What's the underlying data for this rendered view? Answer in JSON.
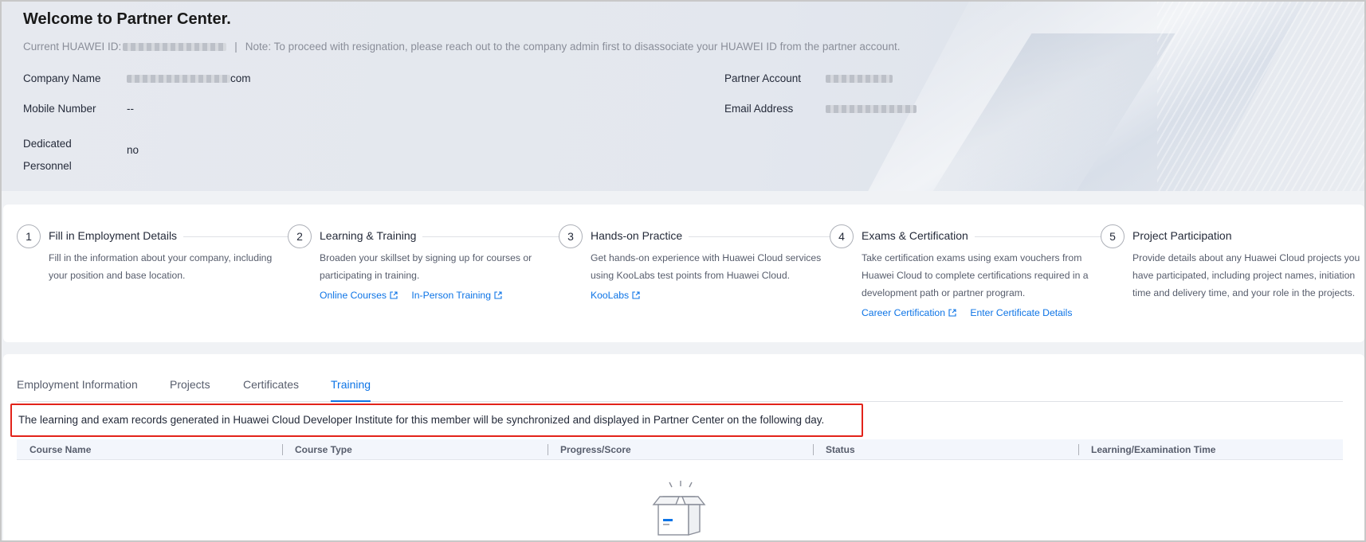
{
  "header": {
    "welcome": "Welcome to Partner Center.",
    "huawei_id_label": "Current HUAWEI ID:",
    "separator": "|",
    "note": "Note: To proceed with resignation, please reach out to the company admin first to disassociate your HUAWEI ID from the partner account.",
    "fields": {
      "company_name_label": "Company Name",
      "company_name_suffix": "com",
      "mobile_label": "Mobile Number",
      "mobile_value": "--",
      "dedicated_label_line1": "Dedicated",
      "dedicated_label_line2": "Personnel",
      "dedicated_value": "no",
      "partner_account_label": "Partner Account",
      "email_label": "Email Address"
    }
  },
  "steps": [
    {
      "num": "1",
      "title": "Fill in Employment Details",
      "desc": "Fill in the information about your company, including your position and base location.",
      "links": []
    },
    {
      "num": "2",
      "title": "Learning & Training",
      "desc": "Broaden your skillset by signing up for courses or participating in training.",
      "links": [
        "Online Courses",
        "In-Person Training"
      ]
    },
    {
      "num": "3",
      "title": "Hands-on Practice",
      "desc": "Get hands-on experience with Huawei Cloud services using KooLabs test points from Huawei Cloud.",
      "links": [
        "KooLabs"
      ]
    },
    {
      "num": "4",
      "title": "Exams & Certification",
      "desc": "Take certification exams using exam vouchers from Huawei Cloud to complete certifications required in a development path or partner program.",
      "links": [
        "Career Certification",
        "Enter Certificate Details"
      ]
    },
    {
      "num": "5",
      "title": "Project Participation",
      "desc": "Provide details about any Huawei Cloud projects you have participated, including project names, initiation time and delivery time, and your role in the projects.",
      "links": []
    }
  ],
  "tabs": {
    "items": [
      "Employment Information",
      "Projects",
      "Certificates",
      "Training"
    ],
    "active": "Training"
  },
  "notice": "The learning and exam records generated in Huawei Cloud Developer Institute for this member will be synchronized and displayed in Partner Center on the following day.",
  "table": {
    "columns": [
      "Course Name",
      "Course Type",
      "Progress/Score",
      "Status",
      "Learning/Examination Time"
    ]
  },
  "colors": {
    "accent": "#0d74e6",
    "highlight_border": "#e2231a",
    "text": "#252b3a",
    "muted": "#575d6c"
  },
  "icons": {
    "external_link": "external-link-icon",
    "empty_state": "empty-box-icon"
  }
}
